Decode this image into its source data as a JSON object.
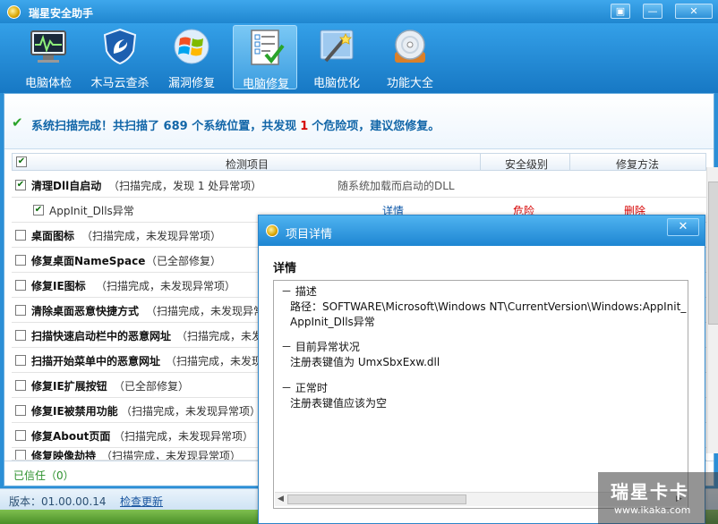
{
  "window": {
    "title": "瑞星安全助手"
  },
  "toolbar": {
    "items": [
      {
        "label": "电脑体检",
        "icon": "monitor-health-icon"
      },
      {
        "label": "木马云查杀",
        "icon": "shield-icon"
      },
      {
        "label": "漏洞修复",
        "icon": "windows-logo-icon"
      },
      {
        "label": "电脑修复",
        "icon": "checklist-icon",
        "active": true
      },
      {
        "label": "电脑优化",
        "icon": "magic-wand-icon"
      },
      {
        "label": "功能大全",
        "icon": "disc-icon"
      }
    ]
  },
  "summary": {
    "prefix": "系统扫描完成！共扫描了",
    "scanned": "689",
    "middle": "个系统位置，共发现",
    "danger_count": "1",
    "suffix": "个危险项，建议您修复。"
  },
  "table": {
    "headers": {
      "item": "检测项目",
      "level": "安全级别",
      "method": "修复方法"
    },
    "rows": [
      {
        "title": "清理Dll自启动",
        "status": "（扫描完成，发现 1 处异常项）",
        "desc": "随系统加载而启动的DLL",
        "checked": true
      },
      {
        "title": "AppInit_Dlls异常",
        "sub": true,
        "detail": "详情",
        "level": "危险",
        "method": "删除",
        "checked": true
      },
      {
        "title": "桌面图标",
        "status": "（扫描完成，未发现异常项）"
      },
      {
        "title": "修复桌面NameSpace",
        "status": "（已全部修复）"
      },
      {
        "title": "修复IE图标",
        "status": "（扫描完成，未发现异常项）"
      },
      {
        "title": "清除桌面恶意快捷方式",
        "status": "（扫描完成，未发现异常项）"
      },
      {
        "title": "扫描快速启动栏中的恶意网址",
        "status": "（扫描完成，未发现异常项）"
      },
      {
        "title": "扫描开始菜单中的恶意网址",
        "status": "（扫描完成，未发现异常项）"
      },
      {
        "title": "修复IE扩展按钮",
        "status": "（已全部修复）"
      },
      {
        "title": "修复IE被禁用功能",
        "status": "（扫描完成，未发现异常项）"
      },
      {
        "title": "修复About页面",
        "status": "（扫描完成，未发现异常项）"
      },
      {
        "title": "修复映像劫持",
        "status": "（扫描完成，未发现异常项）"
      }
    ]
  },
  "trusted": {
    "label": "已信任（0）"
  },
  "statusbar": {
    "version": "版本：01.00.00.14",
    "update": "检查更新"
  },
  "dialog": {
    "title": "项目详情",
    "close": "✕",
    "heading": "详情",
    "sections": [
      {
        "label": "－ 描述",
        "lines": [
          "路径：SOFTWARE\\Microsoft\\Windows NT\\CurrentVersion\\Windows:AppInit_",
          "AppInit_Dlls异常"
        ]
      },
      {
        "label": "－ 目前异常状况",
        "lines": [
          "注册表键值为  UmxSbxExw.dll"
        ]
      },
      {
        "label": "－ 正常时",
        "lines": [
          "注册表键值应该为空"
        ]
      }
    ]
  },
  "watermark": {
    "brand": "瑞星卡卡",
    "url": "www.ikaka.com"
  }
}
